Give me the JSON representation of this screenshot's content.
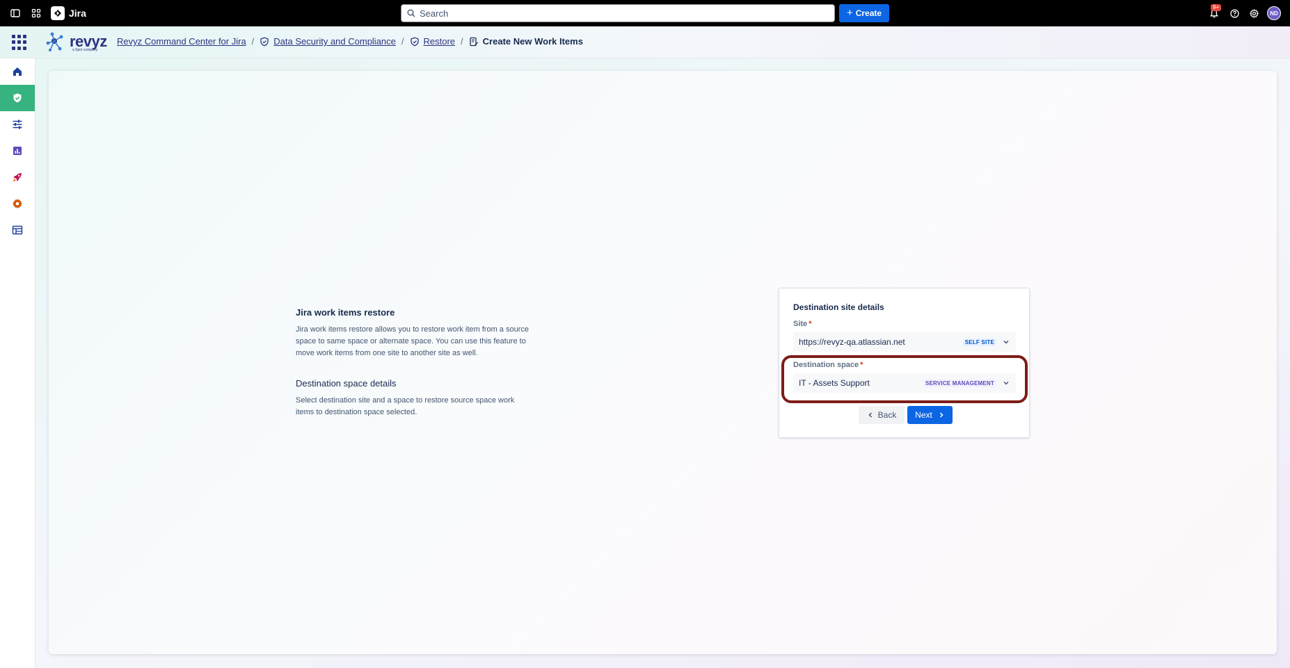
{
  "topnav": {
    "app_name": "Jira",
    "search_placeholder": "Search",
    "create_label": "Create",
    "notification_count": "9+",
    "avatar_initials": "ND"
  },
  "header": {
    "logo_text": "revyz",
    "logo_sub": "a Spot company",
    "breadcrumbs": [
      "Revyz Command Center for Jira",
      "Data Security and Compliance",
      "Restore",
      "Create New Work Items"
    ]
  },
  "sidebar": {
    "items": [
      "home-icon",
      "shield-icon",
      "sliders-icon",
      "chart-icon",
      "rocket-icon",
      "gear-icon",
      "table-icon"
    ],
    "active_index": 1,
    "accent": "#36b37e"
  },
  "info": {
    "title": "Jira work items restore",
    "description": "Jira work items restore allows you to restore work item from a source space to same space or alternate space. You can use this feature to move work items from one site to another site as well.",
    "section_title": "Destination space details",
    "section_description": "Select destination site and a space to restore source space work items to destination space selected."
  },
  "form": {
    "title": "Destination site details",
    "site_label": "Site",
    "site_value": "https://revyz-qa.atlassian.net",
    "site_tag": "SELF SITE",
    "space_label": "Destination space",
    "space_value": "IT - Assets Support",
    "space_tag": "SERVICE MANAGEMENT",
    "required_mark": "*",
    "back_label": "Back",
    "next_label": "Next"
  },
  "colors": {
    "primary": "#0c66e4",
    "brand": "#2b3480",
    "highlight": "#7d1c17",
    "required": "#de350b"
  }
}
